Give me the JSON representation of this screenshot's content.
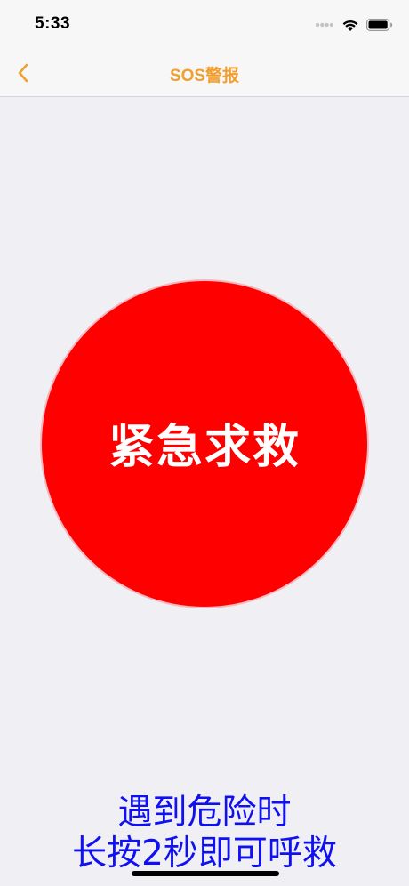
{
  "status_bar": {
    "time": "5:33"
  },
  "nav": {
    "title": "SOS警报",
    "back_icon": "chevron-left-icon",
    "accent_color": "#f0a030"
  },
  "sos_button": {
    "label": "紧急求救",
    "color": "#ff0000"
  },
  "hint": {
    "line1": "遇到危险时",
    "line2": "长按2秒即可呼救",
    "color": "#1010f0"
  }
}
